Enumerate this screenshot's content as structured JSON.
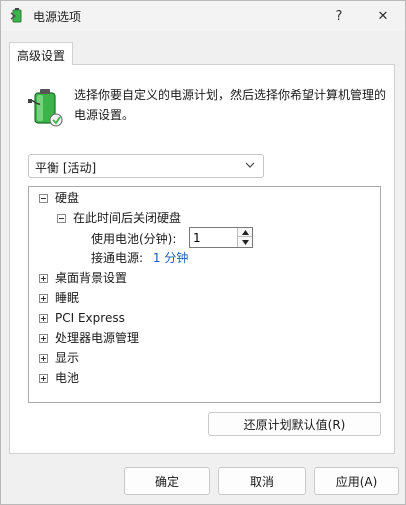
{
  "window": {
    "title": "电源选项",
    "help_glyph": "?",
    "close_glyph": "✕",
    "icons": [
      "power-options-icon",
      "help-icon",
      "close-icon"
    ]
  },
  "tabs": [
    {
      "label": "高级设置",
      "selected": true
    }
  ],
  "panel": {
    "description": "选择你要自定义的电源计划，然后选择你希望计算机管理的电源设置。",
    "plan_select": {
      "value": "平衡 [活动]"
    }
  },
  "tree": {
    "items": [
      {
        "label": "硬盘",
        "expanded": true
      },
      {
        "label": "在此时间后关闭硬盘",
        "expanded": true
      },
      {
        "label": "桌面背景设置",
        "expanded": false
      },
      {
        "label": "睡眠",
        "expanded": false
      },
      {
        "label": "PCI Express",
        "expanded": false
      },
      {
        "label": "处理器电源管理",
        "expanded": false
      },
      {
        "label": "显示",
        "expanded": false
      },
      {
        "label": "电池",
        "expanded": false
      }
    ],
    "battery_setting": {
      "label": "使用电池(分钟):",
      "value": "1"
    },
    "plugged_setting": {
      "label": "接通电源:",
      "value": "1 分钟"
    }
  },
  "buttons": {
    "restore": "还原计划默认值(R)",
    "ok": "确定",
    "cancel": "取消",
    "apply": "应用(A)"
  },
  "colors": {
    "accent_link": "#1a5fb4",
    "battery_green": "#3bb54a"
  }
}
